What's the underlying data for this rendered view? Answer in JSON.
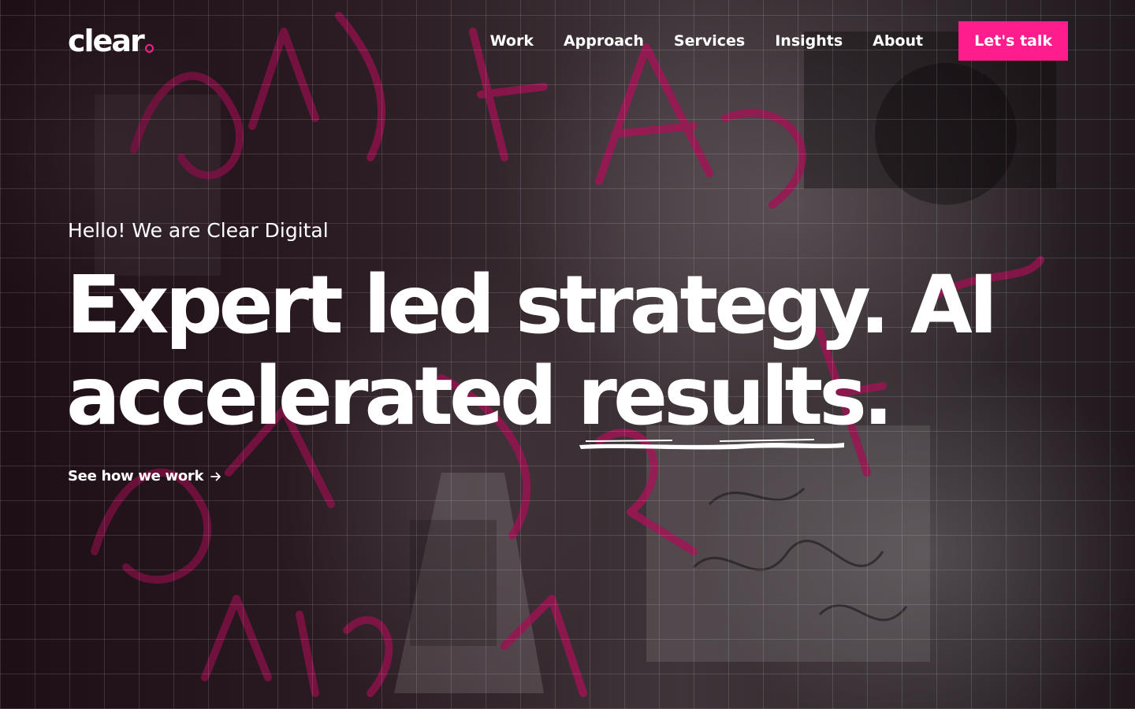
{
  "brand": {
    "logo_text": "clear",
    "accent_color": "#ff1d8e"
  },
  "nav": {
    "items": [
      {
        "label": "Work"
      },
      {
        "label": "Approach"
      },
      {
        "label": "Services"
      },
      {
        "label": "Insights"
      },
      {
        "label": "About"
      }
    ],
    "cta_label": "Let's talk"
  },
  "hero": {
    "eyebrow": "Hello! We are Clear Digital",
    "headline_line1": "Expert led strategy. AI",
    "headline_line2_prefix": "accelerated ",
    "headline_underlined": "results",
    "headline_suffix": ".",
    "link_label": "See how we work",
    "link_icon": "arrow-right-icon"
  }
}
